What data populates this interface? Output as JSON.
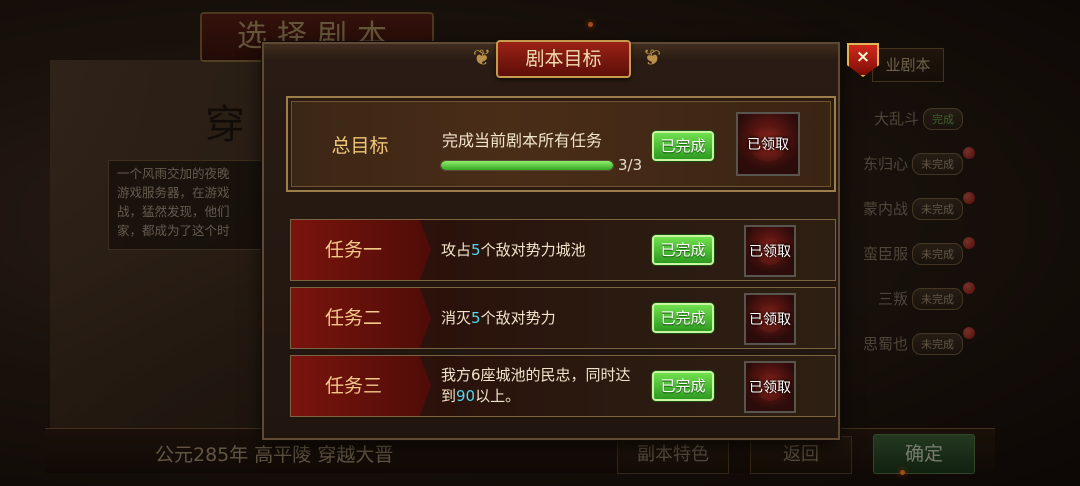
{
  "background": {
    "title": "选择剧本",
    "big_char": "穿",
    "description": "一个风雨交加的夜晚\n游戏服务器，在游戏\n战，猛然发现，他们\n家，都成为了这个时",
    "right_tab": "业剧本",
    "list": [
      {
        "name": "大乱斗",
        "status": "完成"
      },
      {
        "name": "东归心",
        "status": "未完成"
      },
      {
        "name": "蒙内战",
        "status": "未完成"
      },
      {
        "name": "蛮臣服",
        "status": "未完成"
      },
      {
        "name": "三叛",
        "status": "未完成"
      },
      {
        "name": "思蜀也",
        "status": "未完成"
      }
    ],
    "bottom_year": "公元285年 高平陵 穿越大晋",
    "bottom_btn_1": "副本特色",
    "bottom_btn_2": "返回",
    "confirm": "确定"
  },
  "dialog": {
    "title": "剧本目标",
    "close_label": "×",
    "total": {
      "label": "总目标",
      "desc": "完成当前剧本所有任务",
      "progress_text": "3/3",
      "progress": 1.0,
      "status": "已完成",
      "reward": "已领取"
    },
    "tasks": [
      {
        "label": "任务一",
        "desc_pre": "攻占",
        "desc_num": "5",
        "desc_post": "个敌对势力城池",
        "status": "已完成",
        "reward": "已领取"
      },
      {
        "label": "任务二",
        "desc_pre": "消灭",
        "desc_num": "5",
        "desc_post": "个敌对势力",
        "status": "已完成",
        "reward": "已领取"
      },
      {
        "label": "任务三",
        "desc_pre": "我方6座城池的民忠，同时达到",
        "desc_num": "90",
        "desc_post": "以上。",
        "status": "已完成",
        "reward": "已领取"
      }
    ]
  },
  "colors": {
    "accent_gold": "#f0c67a",
    "complete_green": "#4fc232",
    "highlight_cyan": "#52d7ef"
  }
}
